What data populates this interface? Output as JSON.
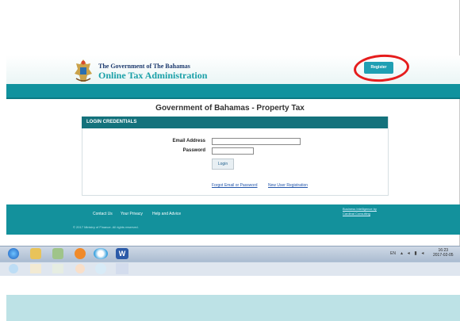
{
  "header": {
    "title_line1": "The Government of The Bahamas",
    "title_line2": "Online Tax Administration",
    "register_label": "Register"
  },
  "main": {
    "heading": "Government of Bahamas - Property Tax",
    "card_title": "LOGIN CREDENTIALS",
    "email_label": "Email Address",
    "email_value": "",
    "password_label": "Password",
    "password_value": "",
    "login_label": "Login",
    "forgot_link": "Forgot Email or Password",
    "new_user_link": "New User Registration"
  },
  "footer": {
    "links": [
      "Contact Us",
      "Your Privacy",
      "Help and Advice"
    ],
    "copyright": "© 2017 Ministry of Finance. All rights reserved.",
    "credit_line1": "Business Intelligence by",
    "credit_line2": "Cardinal Consulting"
  },
  "taskbar": {
    "lang": "EN",
    "time": "16:23",
    "date": "2017-02-05"
  },
  "colors": {
    "teal": "#10929e",
    "dark_teal": "#14727c",
    "annotation_red": "#e51d1d"
  }
}
